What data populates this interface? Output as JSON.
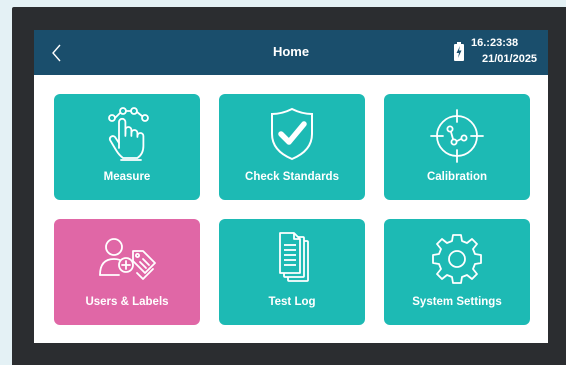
{
  "header": {
    "title": "Home",
    "time": "16.:23:38",
    "date": "21/01/2025",
    "back_icon": "chevron-left-icon",
    "battery_icon": "battery-charging-icon",
    "color": "#1a4e6c"
  },
  "tiles": [
    {
      "label": "Measure",
      "icon": "hand-touch-icon",
      "color": "#1dbab4"
    },
    {
      "label": "Check Standards",
      "icon": "shield-check-icon",
      "color": "#1dbab4"
    },
    {
      "label": "Calibration",
      "icon": "crosshair-target-icon",
      "color": "#1dbab4"
    },
    {
      "label": "Users & Labels",
      "icon": "user-add-tag-icon",
      "color": "#e067a6"
    },
    {
      "label": "Test Log",
      "icon": "documents-icon",
      "color": "#1dbab4"
    },
    {
      "label": "System Settings",
      "icon": "gear-icon",
      "color": "#1dbab4"
    }
  ]
}
